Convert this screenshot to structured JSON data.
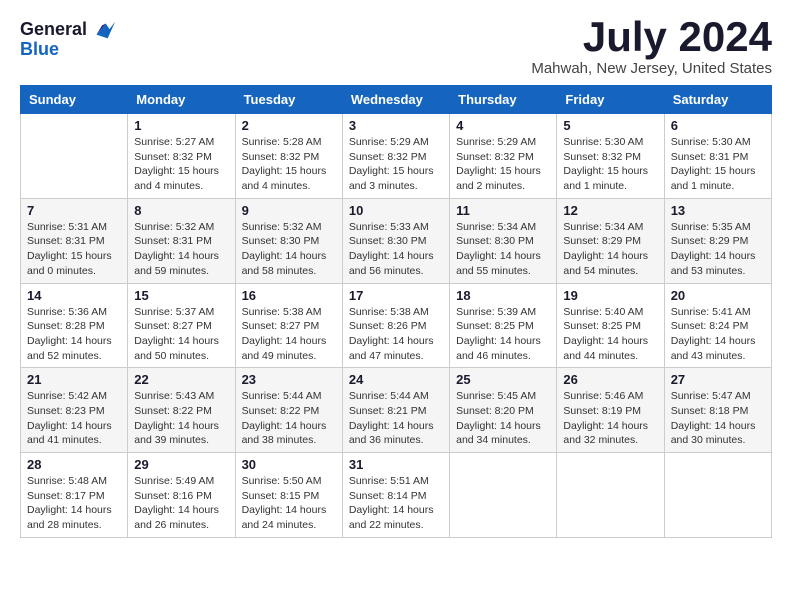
{
  "header": {
    "logo_line1": "General",
    "logo_line2": "Blue",
    "month_title": "July 2024",
    "location": "Mahwah, New Jersey, United States"
  },
  "days_of_week": [
    "Sunday",
    "Monday",
    "Tuesday",
    "Wednesday",
    "Thursday",
    "Friday",
    "Saturday"
  ],
  "weeks": [
    [
      {
        "day": "",
        "info": ""
      },
      {
        "day": "1",
        "info": "Sunrise: 5:27 AM\nSunset: 8:32 PM\nDaylight: 15 hours\nand 4 minutes."
      },
      {
        "day": "2",
        "info": "Sunrise: 5:28 AM\nSunset: 8:32 PM\nDaylight: 15 hours\nand 4 minutes."
      },
      {
        "day": "3",
        "info": "Sunrise: 5:29 AM\nSunset: 8:32 PM\nDaylight: 15 hours\nand 3 minutes."
      },
      {
        "day": "4",
        "info": "Sunrise: 5:29 AM\nSunset: 8:32 PM\nDaylight: 15 hours\nand 2 minutes."
      },
      {
        "day": "5",
        "info": "Sunrise: 5:30 AM\nSunset: 8:32 PM\nDaylight: 15 hours\nand 1 minute."
      },
      {
        "day": "6",
        "info": "Sunrise: 5:30 AM\nSunset: 8:31 PM\nDaylight: 15 hours\nand 1 minute."
      }
    ],
    [
      {
        "day": "7",
        "info": "Sunrise: 5:31 AM\nSunset: 8:31 PM\nDaylight: 15 hours\nand 0 minutes."
      },
      {
        "day": "8",
        "info": "Sunrise: 5:32 AM\nSunset: 8:31 PM\nDaylight: 14 hours\nand 59 minutes."
      },
      {
        "day": "9",
        "info": "Sunrise: 5:32 AM\nSunset: 8:30 PM\nDaylight: 14 hours\nand 58 minutes."
      },
      {
        "day": "10",
        "info": "Sunrise: 5:33 AM\nSunset: 8:30 PM\nDaylight: 14 hours\nand 56 minutes."
      },
      {
        "day": "11",
        "info": "Sunrise: 5:34 AM\nSunset: 8:30 PM\nDaylight: 14 hours\nand 55 minutes."
      },
      {
        "day": "12",
        "info": "Sunrise: 5:34 AM\nSunset: 8:29 PM\nDaylight: 14 hours\nand 54 minutes."
      },
      {
        "day": "13",
        "info": "Sunrise: 5:35 AM\nSunset: 8:29 PM\nDaylight: 14 hours\nand 53 minutes."
      }
    ],
    [
      {
        "day": "14",
        "info": "Sunrise: 5:36 AM\nSunset: 8:28 PM\nDaylight: 14 hours\nand 52 minutes."
      },
      {
        "day": "15",
        "info": "Sunrise: 5:37 AM\nSunset: 8:27 PM\nDaylight: 14 hours\nand 50 minutes."
      },
      {
        "day": "16",
        "info": "Sunrise: 5:38 AM\nSunset: 8:27 PM\nDaylight: 14 hours\nand 49 minutes."
      },
      {
        "day": "17",
        "info": "Sunrise: 5:38 AM\nSunset: 8:26 PM\nDaylight: 14 hours\nand 47 minutes."
      },
      {
        "day": "18",
        "info": "Sunrise: 5:39 AM\nSunset: 8:25 PM\nDaylight: 14 hours\nand 46 minutes."
      },
      {
        "day": "19",
        "info": "Sunrise: 5:40 AM\nSunset: 8:25 PM\nDaylight: 14 hours\nand 44 minutes."
      },
      {
        "day": "20",
        "info": "Sunrise: 5:41 AM\nSunset: 8:24 PM\nDaylight: 14 hours\nand 43 minutes."
      }
    ],
    [
      {
        "day": "21",
        "info": "Sunrise: 5:42 AM\nSunset: 8:23 PM\nDaylight: 14 hours\nand 41 minutes."
      },
      {
        "day": "22",
        "info": "Sunrise: 5:43 AM\nSunset: 8:22 PM\nDaylight: 14 hours\nand 39 minutes."
      },
      {
        "day": "23",
        "info": "Sunrise: 5:44 AM\nSunset: 8:22 PM\nDaylight: 14 hours\nand 38 minutes."
      },
      {
        "day": "24",
        "info": "Sunrise: 5:44 AM\nSunset: 8:21 PM\nDaylight: 14 hours\nand 36 minutes."
      },
      {
        "day": "25",
        "info": "Sunrise: 5:45 AM\nSunset: 8:20 PM\nDaylight: 14 hours\nand 34 minutes."
      },
      {
        "day": "26",
        "info": "Sunrise: 5:46 AM\nSunset: 8:19 PM\nDaylight: 14 hours\nand 32 minutes."
      },
      {
        "day": "27",
        "info": "Sunrise: 5:47 AM\nSunset: 8:18 PM\nDaylight: 14 hours\nand 30 minutes."
      }
    ],
    [
      {
        "day": "28",
        "info": "Sunrise: 5:48 AM\nSunset: 8:17 PM\nDaylight: 14 hours\nand 28 minutes."
      },
      {
        "day": "29",
        "info": "Sunrise: 5:49 AM\nSunset: 8:16 PM\nDaylight: 14 hours\nand 26 minutes."
      },
      {
        "day": "30",
        "info": "Sunrise: 5:50 AM\nSunset: 8:15 PM\nDaylight: 14 hours\nand 24 minutes."
      },
      {
        "day": "31",
        "info": "Sunrise: 5:51 AM\nSunset: 8:14 PM\nDaylight: 14 hours\nand 22 minutes."
      },
      {
        "day": "",
        "info": ""
      },
      {
        "day": "",
        "info": ""
      },
      {
        "day": "",
        "info": ""
      }
    ]
  ]
}
